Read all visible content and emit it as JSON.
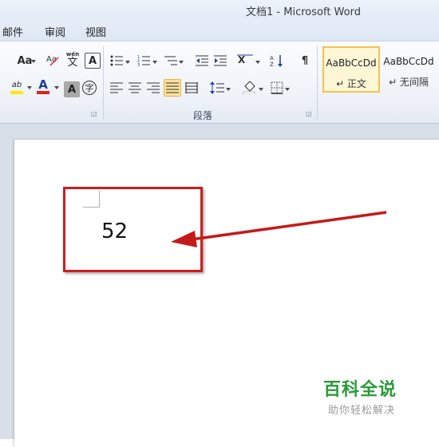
{
  "window": {
    "title": "文档1  -  Microsoft Word"
  },
  "tabs": [
    "邮件",
    "审阅",
    "视图"
  ],
  "ribbon": {
    "font_size_label": "Aa",
    "font_color_label": "A",
    "char_shading_label": "A",
    "enclose_char_label": "字",
    "highlight_label": "ab",
    "phonetic_label": "wén",
    "phonetic_char": "文",
    "paragraph_group_label": "段落",
    "styles": [
      {
        "sample": "AaBbCcDd",
        "name": "↵ 正文"
      },
      {
        "sample": "AaBbCcDd",
        "name": "↵ 无间隔"
      }
    ],
    "selected_style_index": 0
  },
  "document": {
    "page_number_text": "52"
  },
  "watermark": {
    "title": "百科全说",
    "subtitle": "助你轻松解决"
  },
  "colors": {
    "annotation_red": "#cc1e1e",
    "watermark_green": "#2a9a3a",
    "style_highlight": "#f2c350"
  }
}
